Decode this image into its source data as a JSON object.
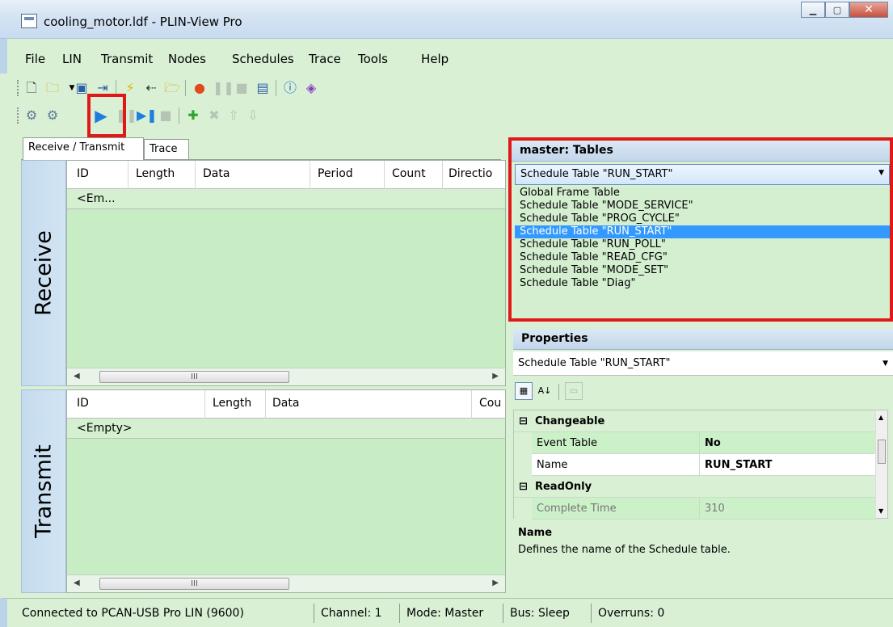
{
  "window": {
    "title": "cooling_motor.ldf - PLIN-View Pro",
    "minimize_icon": "minimize-icon",
    "maximize_icon": "maximize-icon",
    "close_icon": "close-icon"
  },
  "menu": [
    "File",
    "LIN",
    "Transmit",
    "Nodes",
    "Schedules",
    "Trace",
    "Tools",
    "Help"
  ],
  "toolbar1": {
    "icons": [
      "new-file-icon",
      "open-folder-icon",
      "save-icon",
      "import-icon",
      "connect-icon",
      "disconnect-icon",
      "folder-icon",
      "record-icon",
      "pause-icon",
      "stop-icon",
      "save-trace-icon",
      "info-icon",
      "help-book-icon"
    ]
  },
  "toolbar2": {
    "icons": [
      "add-node-icon",
      "remove-node-icon",
      "play-icon",
      "pause-icon",
      "step-icon",
      "stop-icon",
      "add-icon",
      "delete-icon",
      "move-up-icon",
      "move-down-icon"
    ]
  },
  "tabs": [
    "Receive / Transmit",
    "Trace"
  ],
  "receive": {
    "label": "Receive",
    "columns": [
      "ID",
      "Length",
      "Data",
      "Period",
      "Count",
      "Directio"
    ],
    "rows": [
      "<Em..."
    ],
    "scroll_thumb": "III"
  },
  "transmit": {
    "label": "Transmit",
    "columns": [
      "ID",
      "Length",
      "Data",
      "Cou"
    ],
    "rows": [
      "<Empty>"
    ],
    "scroll_thumb": "III"
  },
  "tables_panel": {
    "title": "master: Tables",
    "selected": "Schedule Table \"RUN_START\"",
    "options": [
      "Global Frame Table",
      "Schedule Table \"MODE_SERVICE\"",
      "Schedule Table \"PROG_CYCLE\"",
      "Schedule Table \"RUN_START\"",
      "Schedule Table \"RUN_POLL\"",
      "Schedule Table \"READ_CFG\"",
      "Schedule Table \"MODE_SET\"",
      "Schedule Table \"Diag\""
    ],
    "selected_index": 3
  },
  "properties_panel": {
    "title": "Properties",
    "object": "Schedule Table \"RUN_START\"",
    "categories": [
      {
        "name": "Changeable",
        "expander": "⊟",
        "rows": [
          {
            "name": "Event Table",
            "value": "No"
          },
          {
            "name": "Name",
            "value": "RUN_START"
          }
        ]
      },
      {
        "name": "ReadOnly",
        "expander": "⊟",
        "rows": [
          {
            "name": "Complete Time",
            "value": "310"
          }
        ]
      }
    ],
    "description_title": "Name",
    "description_text": "Defines the name of the Schedule table."
  },
  "statusbar": {
    "connection": "Connected to PCAN-USB Pro LIN (9600)",
    "channel": "Channel: 1",
    "mode": "Mode: Master",
    "bus": "Bus: Sleep",
    "overruns": "Overruns: 0"
  },
  "colors": {
    "background": "#d9f0d5",
    "highlight": "#e01818",
    "selection": "#3399ff"
  }
}
